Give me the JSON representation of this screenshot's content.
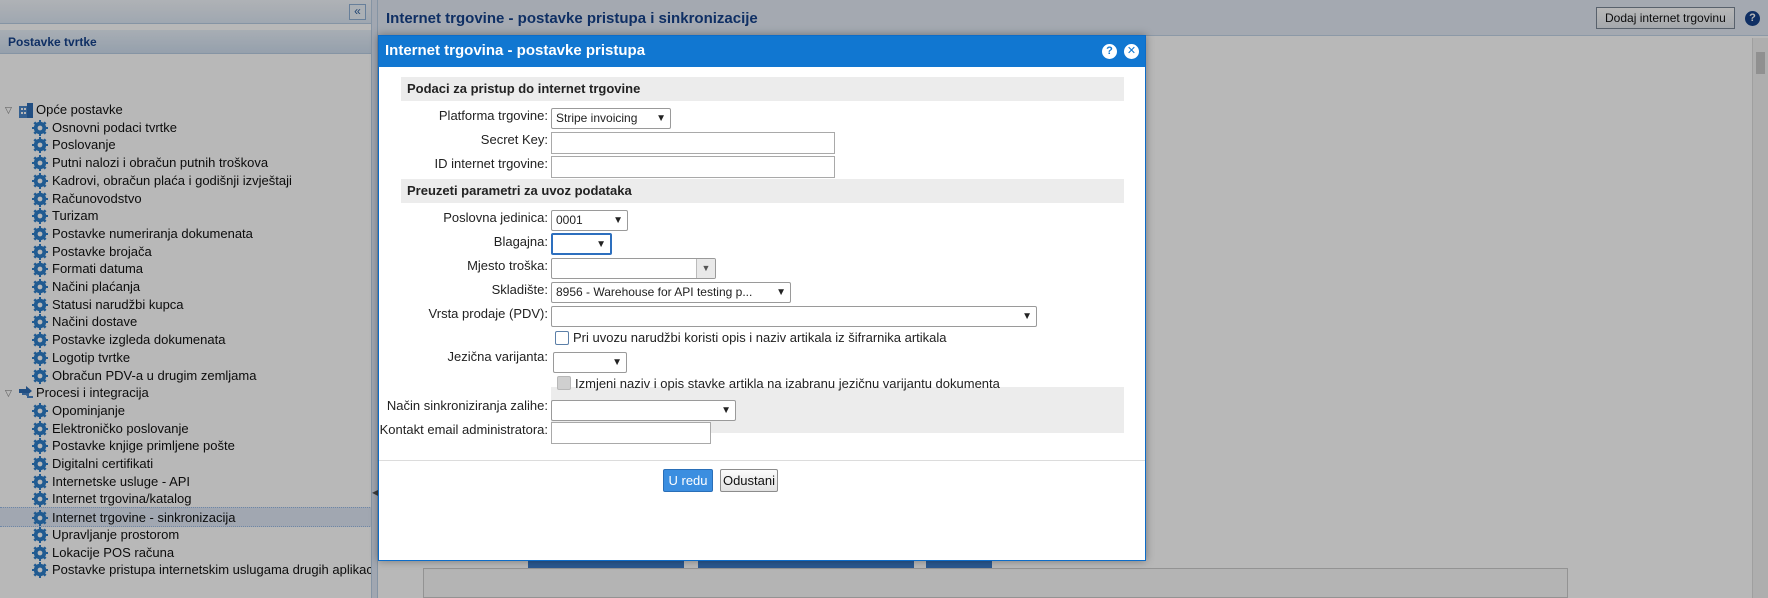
{
  "sidebar": {
    "collapse_glyph": "«",
    "title": "Postavke tvrtke",
    "groups": [
      {
        "label": "Opće postavke",
        "items": [
          "Osnovni podaci tvrtke",
          "Poslovanje",
          "Putni nalozi i obračun putnih troškova",
          "Kadrovi, obračun plaća i godišnji izvještaji",
          "Računovodstvo",
          "Turizam",
          "Postavke numeriranja dokumenata",
          "Postavke brojača",
          "Formati datuma",
          "Načini plaćanja",
          "Statusi narudžbi kupca",
          "Načini dostave",
          "Postavke izgleda dokumenata",
          "Logotip tvrtke",
          "Obračun PDV-a u drugim zemljama"
        ]
      },
      {
        "label": "Procesi i integracija",
        "items": [
          "Opominjanje",
          "Elektroničko poslovanje",
          "Postavke knjige primljene pošte",
          "Digitalni certifikati",
          "Internetske usluge - API",
          "Internet trgovina/katalog",
          "Internet trgovine - sinkronizacija",
          "Upravljanje prostorom",
          "Lokacije POS računa",
          "Postavke pristupa internetskim uslugama drugih aplikacija"
        ]
      }
    ],
    "selected_item": "Internet trgovine - sinkronizacija"
  },
  "main": {
    "title": "Internet trgovine - postavke pristupa i sinkronizacije",
    "add_button": "Dodaj internet trgovinu",
    "help_glyph": "?"
  },
  "dialog": {
    "title": "Internet trgovina - postavke pristupa",
    "help_glyph": "?",
    "close_glyph": "✕",
    "section_access": "Podaci za pristup do internet trgovine",
    "platform_label": "Platforma trgovine:",
    "platform_value": "Stripe invoicing",
    "secret_key_label": "Secret Key:",
    "secret_key_value": "",
    "shop_id_label": "ID internet trgovine:",
    "shop_id_value": "",
    "section_import": "Preuzeti parametri za uvoz podataka",
    "business_unit_label": "Poslovna jedinica:",
    "business_unit_value": "0001",
    "cash_register_label": "Blagajna:",
    "cash_register_value": "",
    "cost_center_label": "Mjesto troška:",
    "cost_center_value": "",
    "warehouse_label": "Skladište:",
    "warehouse_value": "8956 - Warehouse for API testing p...",
    "sale_type_label": "Vrsta prodaje (PDV):",
    "sale_type_value": "",
    "use_catalog_desc_label": "Pri uvozu narudžbi koristi opis i naziv artikala iz šifrarnika artikala",
    "use_catalog_desc_checked": false,
    "language_label": "Jezična varijanta:",
    "language_value": "",
    "change_lang_label": "Izmjeni naziv i opis stavke artikla na izabranu jezičnu varijantu dokumenta",
    "change_lang_checked": false,
    "stock_sync_label": "Način sinkroniziranja zalihe:",
    "stock_sync_value": "",
    "admin_email_label": "Kontakt email administratora:",
    "admin_email_value": "",
    "ok_button": "U redu",
    "cancel_button": "Odustani"
  },
  "icons": {
    "group_open": "triangle-down-icon",
    "folder": "building-icon",
    "process": "arrows-icon",
    "leaf": "gear-icon"
  },
  "colors": {
    "dialog_header": "#1177d1",
    "section_bg": "#ececec",
    "ok_button": "#3b8ee0",
    "tree_title": "#15428b"
  }
}
